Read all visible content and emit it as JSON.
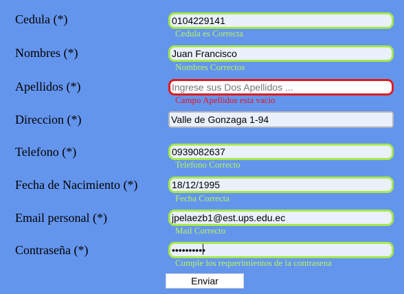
{
  "form": {
    "cedula": {
      "label": "Cedula (*)",
      "value": "0104229141",
      "message": "Cedula es Correcta"
    },
    "nombres": {
      "label": "Nombres (*)",
      "value": "Juan Francisco",
      "message": "Nombres Correctos"
    },
    "apellidos": {
      "label": "Apellidos (*)",
      "value": "",
      "placeholder": "Ingrese sus Dos Apellidos ...",
      "message": "Campo Apellidos esta vacio"
    },
    "direccion": {
      "label": "Direccion (*)",
      "value": "Valle de Gonzaga 1-94"
    },
    "telefono": {
      "label": "Telefono (*)",
      "value": "0939082637",
      "message": "Telefono Correcto"
    },
    "fecha": {
      "label": "Fecha de Nacimiento (*)",
      "value": "18/12/1995",
      "message": "Fecha Correcta"
    },
    "email": {
      "label": "Email personal (*)",
      "value": "jpelaezb1@est.ups.edu.ec",
      "message": "Mail Correcto"
    },
    "password": {
      "label": "Contraseña (*)",
      "value": "••••••••••",
      "message": "Cumple los requerimientos de la contrasena"
    },
    "submit_label": "Enviar"
  },
  "colors": {
    "background": "#6495ed",
    "valid_border": "#a6e84c",
    "valid_message": "#b8f55a",
    "error": "#e01a1a"
  }
}
